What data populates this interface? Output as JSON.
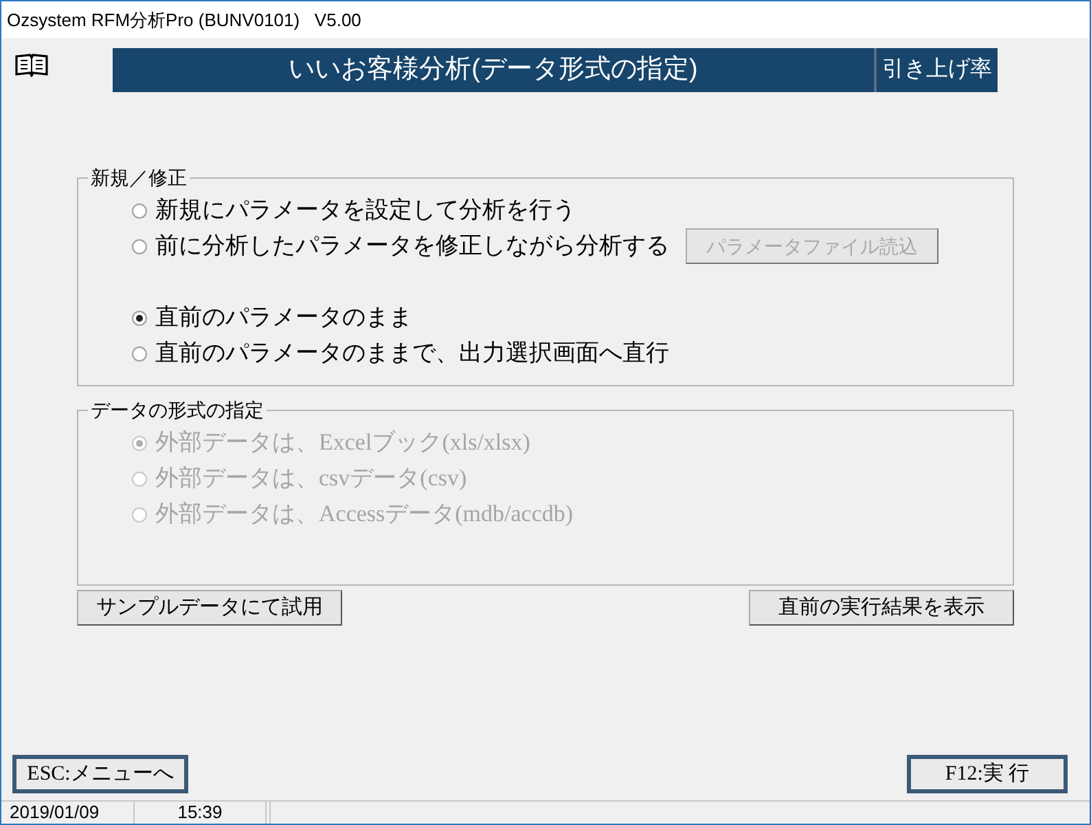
{
  "window": {
    "title": "Ozsystem RFM分析Pro (BUNV0101)   V5.00"
  },
  "header": {
    "title": "いいお客様分析(データ形式の指定)",
    "tag": "引き上げ率"
  },
  "groups": [
    {
      "title": "新規／修正",
      "blocks": [
        [
          {
            "label": "新規にパラメータを設定して分析を行う",
            "selected": false,
            "disabled": false
          },
          {
            "label": "前に分析したパラメータを修正しながら分析する",
            "selected": false,
            "disabled": false,
            "button": {
              "label": "パラメータファイル読込",
              "disabled": true
            }
          }
        ],
        [
          {
            "label": "直前のパラメータのまま",
            "selected": true,
            "disabled": false
          },
          {
            "label": "直前のパラメータのままで、出力選択画面へ直行",
            "selected": false,
            "disabled": false
          }
        ]
      ]
    },
    {
      "title": "データの形式の指定",
      "blocks": [
        [
          {
            "label": "外部データは、Excelブック(xls/xlsx)",
            "selected": true,
            "disabled": true
          },
          {
            "label": "外部データは、csvデータ(csv)",
            "selected": false,
            "disabled": true
          },
          {
            "label": "外部データは、Accessデータ(mdb/accdb)",
            "selected": false,
            "disabled": true
          }
        ]
      ]
    }
  ],
  "actions": [
    "サンプルデータにて試用",
    "直前の実行結果を表示"
  ],
  "footer_buttons": [
    "ESC:メニューへ",
    "F12:実 行"
  ],
  "status_bar": [
    "2019/01/09",
    "15:39"
  ]
}
